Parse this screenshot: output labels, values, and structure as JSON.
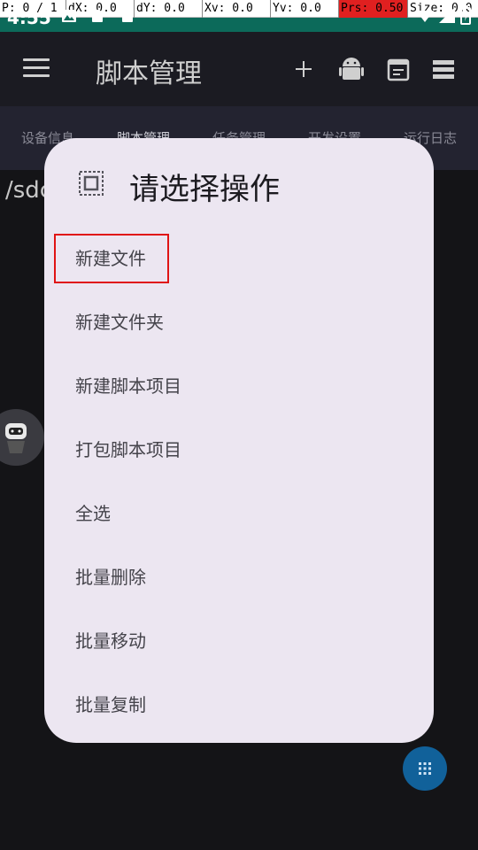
{
  "status_bar": {
    "time": "4:55",
    "pointer_location": {
      "p": "P: 0 / 1",
      "dx": "dX: 0.0",
      "dy": "dY: 0.0",
      "xv": "Xv: 0.0",
      "yv": "Yv: 0.0",
      "prs": "Prs: 0.50",
      "size": "Size: 0.0"
    }
  },
  "toolbar": {
    "title": "脚本管理"
  },
  "tabs": [
    {
      "label": "设备信息"
    },
    {
      "label": "脚本管理"
    },
    {
      "label": "任务管理"
    },
    {
      "label": "开发设置"
    },
    {
      "label": "运行日志"
    }
  ],
  "path_text": "/sdc",
  "dialog": {
    "title": "请选择操作",
    "items": [
      {
        "label": "新建文件"
      },
      {
        "label": "新建文件夹"
      },
      {
        "label": "新建脚本项目"
      },
      {
        "label": "打包脚本项目"
      },
      {
        "label": "全选"
      },
      {
        "label": "批量删除"
      },
      {
        "label": "批量移动"
      },
      {
        "label": "批量复制"
      }
    ]
  },
  "colors": {
    "status_bar": "#0c6a5a",
    "toolbar": "#1b1b22",
    "tabs_bg": "#232330",
    "dialog_bg": "#ece6f1",
    "highlight": "#e01414",
    "fab": "#11619a"
  }
}
